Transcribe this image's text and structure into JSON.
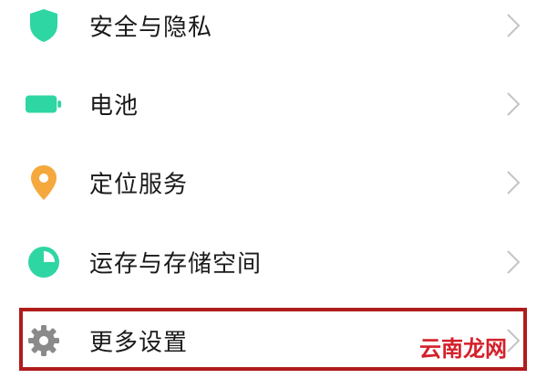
{
  "settings": {
    "items": [
      {
        "label": "安全与隐私",
        "icon": "shield-icon"
      },
      {
        "label": "电池",
        "icon": "battery-icon"
      },
      {
        "label": "定位服务",
        "icon": "location-pin-icon"
      },
      {
        "label": "运存与存储空间",
        "icon": "pie-chart-icon"
      },
      {
        "label": "更多设置",
        "icon": "gear-icon"
      }
    ]
  },
  "colors": {
    "accent": "#2ed6a3",
    "location": "#f5a83c",
    "gear": "#8a8a8a",
    "chevron": "#c4c4c4",
    "highlight_border": "#b01c1c",
    "watermark": "#d4202a"
  },
  "watermark": {
    "text": "云南龙网"
  }
}
